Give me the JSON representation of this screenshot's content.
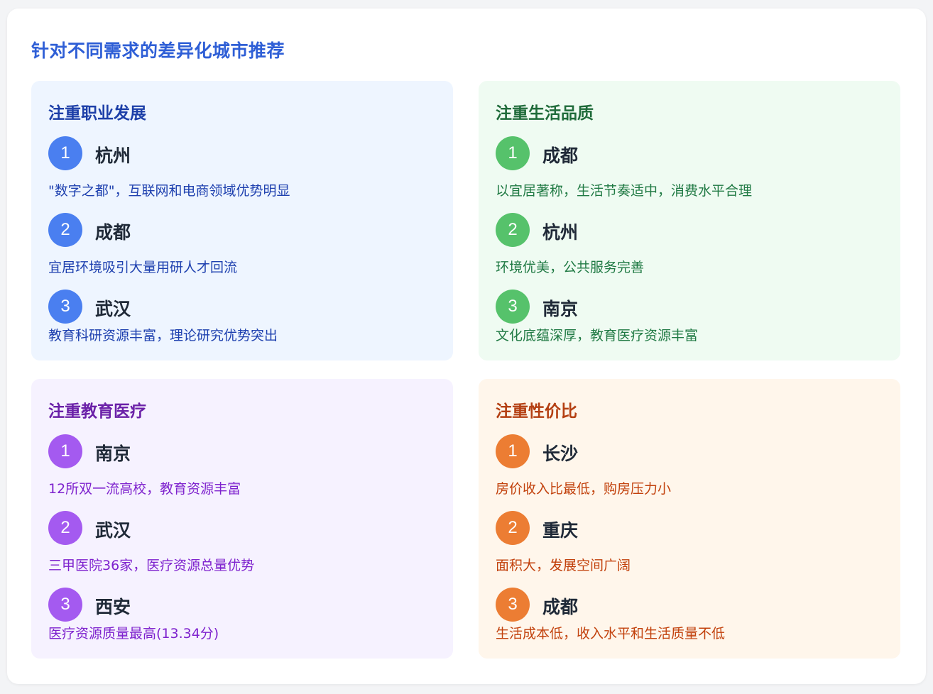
{
  "title": "针对不同需求的差异化城市推荐",
  "groups": [
    {
      "title": "注重职业发展",
      "items": [
        {
          "rank": "1",
          "city": "杭州",
          "desc": "\"数字之都\"，互联网和电商领域优势明显"
        },
        {
          "rank": "2",
          "city": "成都",
          "desc": "宜居环境吸引大量用研人才回流"
        },
        {
          "rank": "3",
          "city": "武汉",
          "desc": "教育科研资源丰富，理论研究优势突出"
        }
      ]
    },
    {
      "title": "注重生活品质",
      "items": [
        {
          "rank": "1",
          "city": "成都",
          "desc": "以宜居著称，生活节奏适中，消费水平合理"
        },
        {
          "rank": "2",
          "city": "杭州",
          "desc": "环境优美，公共服务完善"
        },
        {
          "rank": "3",
          "city": "南京",
          "desc": "文化底蕴深厚，教育医疗资源丰富"
        }
      ]
    },
    {
      "title": "注重教育医疗",
      "items": [
        {
          "rank": "1",
          "city": "南京",
          "desc": "12所双一流高校，教育资源丰富"
        },
        {
          "rank": "2",
          "city": "武汉",
          "desc": "三甲医院36家，医疗资源总量优势"
        },
        {
          "rank": "3",
          "city": "西安",
          "desc": "医疗资源质量最高(13.34分)"
        }
      ]
    },
    {
      "title": "注重性价比",
      "items": [
        {
          "rank": "1",
          "city": "长沙",
          "desc": "房价收入比最低，购房压力小"
        },
        {
          "rank": "2",
          "city": "重庆",
          "desc": "面积大，发展空间广阔"
        },
        {
          "rank": "3",
          "city": "成都",
          "desc": "生活成本低，收入水平和生活质量不低"
        }
      ]
    }
  ]
}
